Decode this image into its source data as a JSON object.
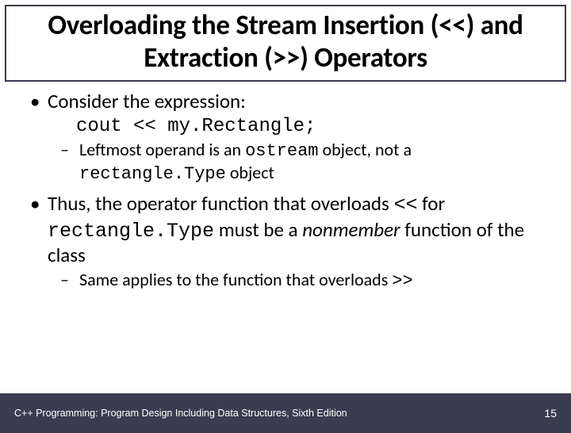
{
  "title": "Overloading the Stream Insertion (<<) and Extraction (>>) Operators",
  "bullets": {
    "b1_text": "Consider the expression:",
    "b1_code": "cout << my.Rectangle;",
    "b1_sub_pre": "Leftmost operand is an ",
    "b1_sub_code1": "ostream",
    "b1_sub_mid": " object, not a ",
    "b1_sub_code2": "rectangle.Type",
    "b1_sub_post": " object",
    "b2_pre": "Thus, the operator function that overloads ",
    "b2_code1": "<<",
    "b2_mid": " for ",
    "b2_code2": "rectangle.Type",
    "b2_mid2": " must be a ",
    "b2_em": "nonmember",
    "b2_post": " function of the class",
    "b2_sub_pre": "Same applies to the function that overloads ",
    "b2_sub_code": ">>"
  },
  "footer": {
    "left": "C++ Programming: Program Design Including Data Structures, Sixth Edition",
    "page": "15"
  }
}
